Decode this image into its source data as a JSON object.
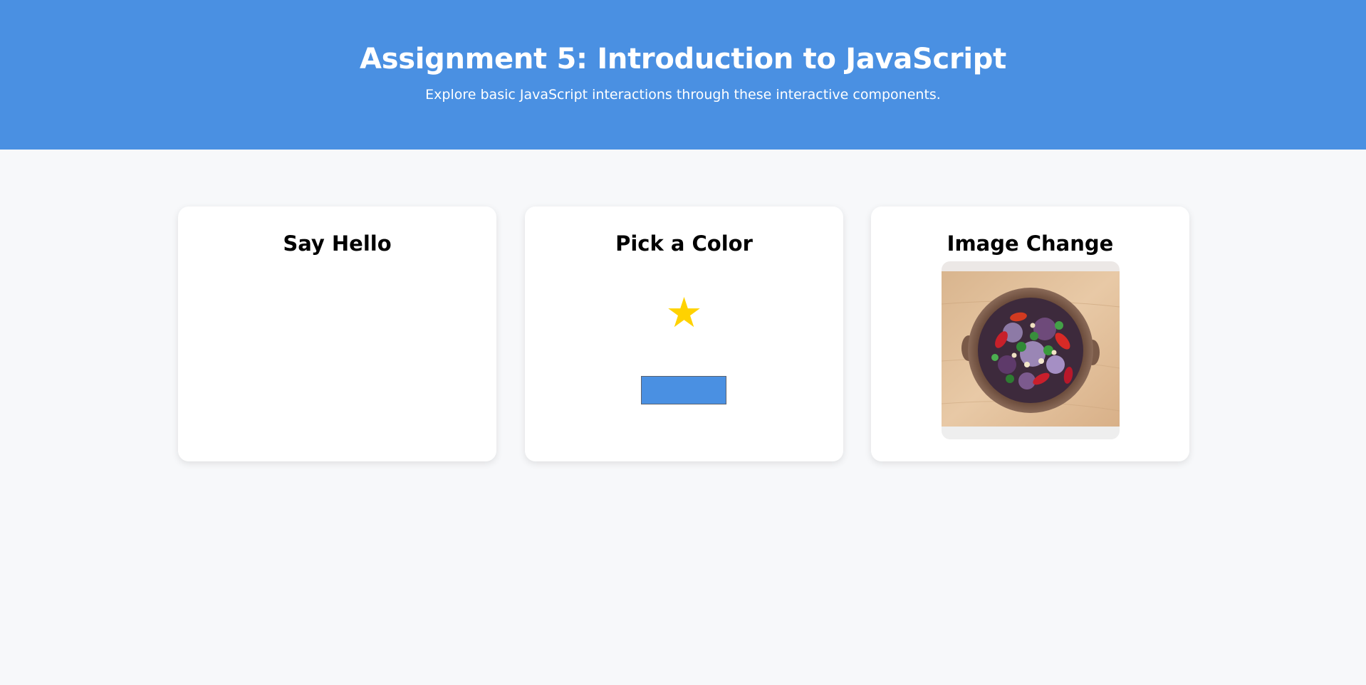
{
  "header": {
    "title": "Assignment 5: Introduction to JavaScript",
    "subtitle": "Explore basic JavaScript interactions through these interactive components."
  },
  "cards": {
    "hello": {
      "title": "Say Hello"
    },
    "color": {
      "title": "Pick a Color",
      "star_icon": "star-icon",
      "star_color": "#ffd200",
      "button_color": "#4a90e2"
    },
    "image": {
      "title": "Image Change",
      "image_subject": "salad-bowl-photo"
    }
  },
  "colors": {
    "header_bg": "#4a90e2",
    "page_bg": "#f7f8fa",
    "card_bg": "#ffffff"
  }
}
